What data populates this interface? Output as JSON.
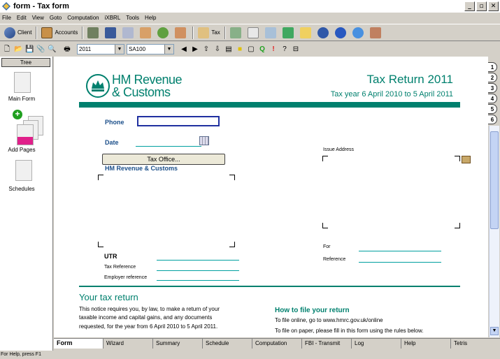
{
  "window": {
    "title": "form - Tax form"
  },
  "menu": [
    "File",
    "Edit",
    "View",
    "Goto",
    "Computation",
    "iXBRL",
    "Tools",
    "Help"
  ],
  "toolbar1": {
    "client_label": "Client",
    "accounts_label": "Accounts",
    "tax_label": "Tax"
  },
  "toolbar2": {
    "year_value": "2011",
    "form_value": "SA100"
  },
  "left_panel": {
    "tree_label": "Tree",
    "main_form_label": "Main Form",
    "add_pages_label": "Add Pages",
    "schedules_label": "Schedules"
  },
  "form": {
    "hmrc_line1": "HM Revenue",
    "hmrc_line2": "& Customs",
    "tax_return_title": "Tax Return 2011",
    "tax_year": "Tax year 6 April 2010 to 5 April 2011",
    "phone_label": "Phone",
    "date_label": "Date",
    "tax_office_button": "Tax Office...",
    "hmrc_address_label": "HM Revenue & Customs",
    "issue_address_label": "Issue Address",
    "utr_label": "UTR",
    "tax_reference_label": "Tax Reference",
    "employer_reference_label": "Employer reference",
    "for_label": "For",
    "reference_label": "Reference",
    "your_tax_return_heading": "Your tax return",
    "notice_line1": "This notice requires you, by law, to make a return of your",
    "notice_line2": "taxable income and capital gains, and any documents",
    "notice_line3": "requested, for the year from 6 April 2010 to 5 April 2011.",
    "how_to_file_heading": "How to file your return",
    "file_online": "To file online, go to www.hmrc.gov.uk/online",
    "file_paper": "To file on paper, please fill in this form using the rules below."
  },
  "right_tabs": [
    "1",
    "2",
    "3",
    "4",
    "5",
    "6"
  ],
  "bottom_tabs": [
    "Form",
    "Wizard",
    "Summary",
    "Schedule",
    "Computation",
    "FBI - Transmit",
    "Log",
    "Help",
    "Tetris"
  ],
  "status": "For Help, press F1"
}
